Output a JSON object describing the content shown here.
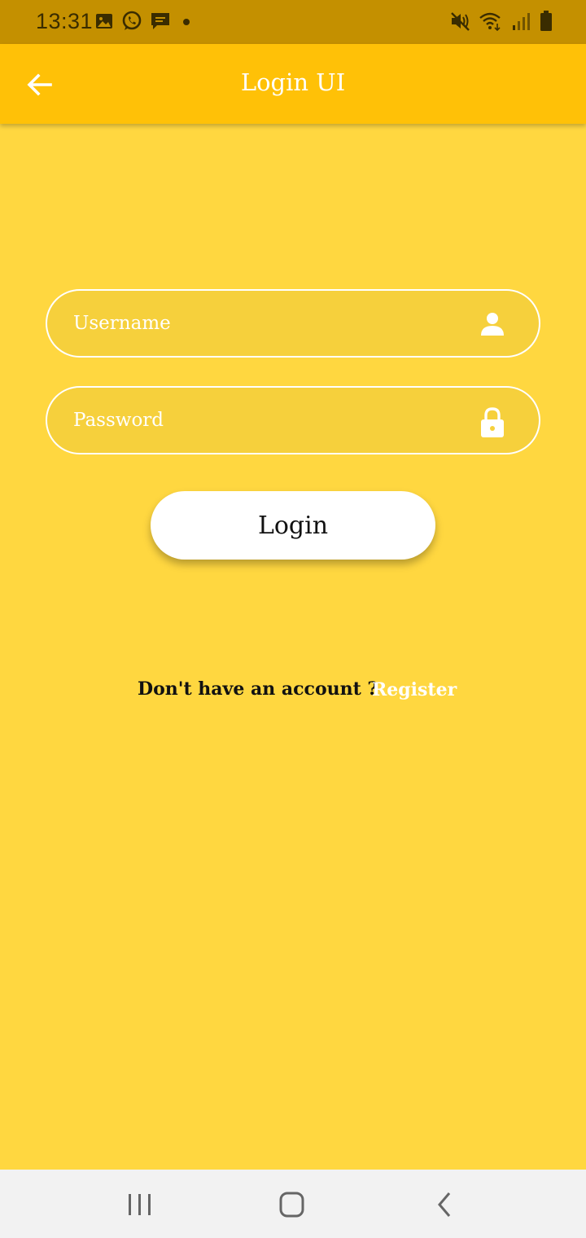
{
  "status_bar": {
    "time": "13:31",
    "left_icons": [
      "image-icon",
      "whatsapp-icon",
      "message-icon",
      "dot-icon"
    ],
    "right_icons": [
      "mute-icon",
      "wifi-icon",
      "signal-icon",
      "battery-icon"
    ]
  },
  "app_bar": {
    "title": "Login UI",
    "back_icon": "arrow-left-icon",
    "color": "#FFC107"
  },
  "form": {
    "username": {
      "placeholder": "Username",
      "value": "",
      "icon": "person-icon"
    },
    "password": {
      "placeholder": "Password",
      "value": "",
      "icon": "lock-icon"
    },
    "login_label": "Login"
  },
  "footer": {
    "prompt": "Don't have an account ?",
    "register_label": "Register"
  },
  "nav_bar": {
    "icons": [
      "recents-icon",
      "home-icon",
      "back-icon"
    ]
  },
  "colors": {
    "background": "#FFD740",
    "status_bar": "#C49000",
    "accent": "#FFC107",
    "field_border": "#FFFFFF",
    "button": "#FFFFFF"
  }
}
